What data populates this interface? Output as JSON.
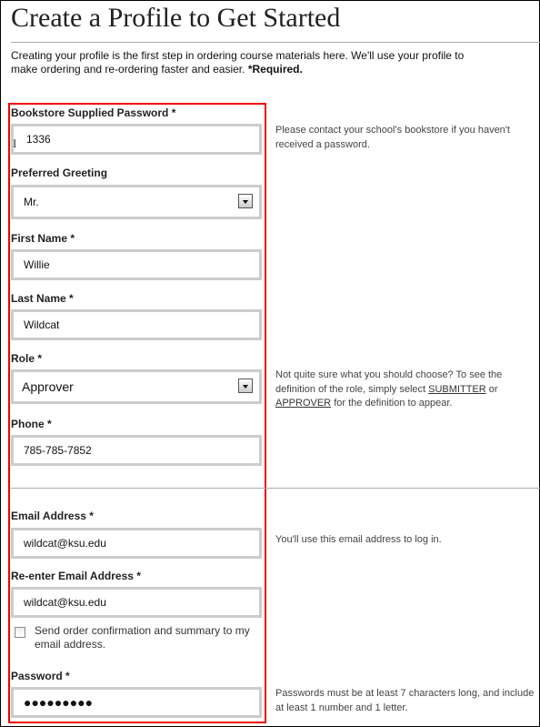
{
  "title": "Create a Profile to Get Started",
  "intro": {
    "text": "Creating your profile is the first step in ordering course materials here. We'll use your profile to make ordering and re-ordering faster and easier. ",
    "required": "*Required."
  },
  "fields": {
    "bookstore_password": {
      "label": "Bookstore Supplied Password *",
      "value": "1336"
    },
    "greeting": {
      "label": "Preferred Greeting",
      "value": "Mr."
    },
    "first_name": {
      "label": "First Name *",
      "value": "Willie"
    },
    "last_name": {
      "label": "Last Name *",
      "value": "Wildcat"
    },
    "role": {
      "label": "Role *",
      "value": "Approver"
    },
    "phone": {
      "label": "Phone *",
      "value": "785-785-7852"
    },
    "email": {
      "label": "Email Address *",
      "value": "wildcat@ksu.edu"
    },
    "email_confirm": {
      "label": "Re-enter Email Address *",
      "value": "wildcat@ksu.edu"
    },
    "send_confirmation": {
      "label": "Send order confirmation and summary to my email address.",
      "checked": false
    },
    "password": {
      "label": "Password *",
      "value": "●●●●●●●●●"
    }
  },
  "help": {
    "bookstore_password": "Please contact your school's bookstore if you haven't received a password.",
    "role_pre": "Not quite sure what you should choose? To see the definition of the role, simply select ",
    "role_link1": "SUBMITTER",
    "role_mid": " or ",
    "role_link2": "APPROVER",
    "role_post": " for the definition to appear.",
    "email": "You'll use this email address to log in.",
    "password": "Passwords must be at least 7 characters long, and include at least 1 number and 1 letter."
  },
  "colors": {
    "highlight": "#e00000",
    "input_border": "#cccccc"
  }
}
